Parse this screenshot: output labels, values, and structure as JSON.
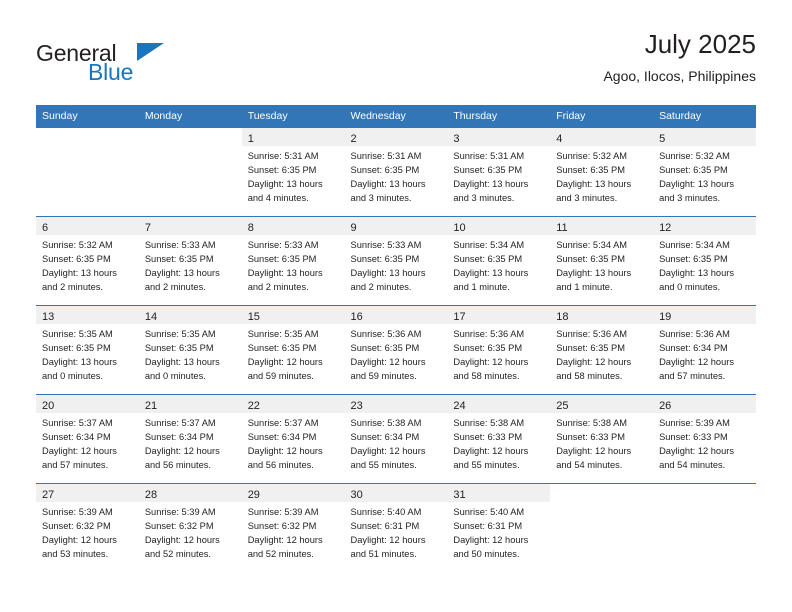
{
  "brand": {
    "name_top": "General",
    "name_bottom": "Blue",
    "triangle_icon": "triangle-logo-icon",
    "accent_color": "#1b75bc"
  },
  "header": {
    "title": "July 2025",
    "subtitle": "Agoo, Ilocos, Philippines"
  },
  "calendar": {
    "header_color": "#3276b8",
    "weekday_headers": [
      "Sunday",
      "Monday",
      "Tuesday",
      "Wednesday",
      "Thursday",
      "Friday",
      "Saturday"
    ],
    "weeks": [
      [
        {
          "day": "",
          "lines": []
        },
        {
          "day": "",
          "lines": []
        },
        {
          "day": "1",
          "lines": [
            "Sunrise: 5:31 AM",
            "Sunset: 6:35 PM",
            "Daylight: 13 hours",
            "and 4 minutes."
          ]
        },
        {
          "day": "2",
          "lines": [
            "Sunrise: 5:31 AM",
            "Sunset: 6:35 PM",
            "Daylight: 13 hours",
            "and 3 minutes."
          ]
        },
        {
          "day": "3",
          "lines": [
            "Sunrise: 5:31 AM",
            "Sunset: 6:35 PM",
            "Daylight: 13 hours",
            "and 3 minutes."
          ]
        },
        {
          "day": "4",
          "lines": [
            "Sunrise: 5:32 AM",
            "Sunset: 6:35 PM",
            "Daylight: 13 hours",
            "and 3 minutes."
          ]
        },
        {
          "day": "5",
          "lines": [
            "Sunrise: 5:32 AM",
            "Sunset: 6:35 PM",
            "Daylight: 13 hours",
            "and 3 minutes."
          ]
        }
      ],
      [
        {
          "day": "6",
          "lines": [
            "Sunrise: 5:32 AM",
            "Sunset: 6:35 PM",
            "Daylight: 13 hours",
            "and 2 minutes."
          ]
        },
        {
          "day": "7",
          "lines": [
            "Sunrise: 5:33 AM",
            "Sunset: 6:35 PM",
            "Daylight: 13 hours",
            "and 2 minutes."
          ]
        },
        {
          "day": "8",
          "lines": [
            "Sunrise: 5:33 AM",
            "Sunset: 6:35 PM",
            "Daylight: 13 hours",
            "and 2 minutes."
          ]
        },
        {
          "day": "9",
          "lines": [
            "Sunrise: 5:33 AM",
            "Sunset: 6:35 PM",
            "Daylight: 13 hours",
            "and 2 minutes."
          ]
        },
        {
          "day": "10",
          "lines": [
            "Sunrise: 5:34 AM",
            "Sunset: 6:35 PM",
            "Daylight: 13 hours",
            "and 1 minute."
          ]
        },
        {
          "day": "11",
          "lines": [
            "Sunrise: 5:34 AM",
            "Sunset: 6:35 PM",
            "Daylight: 13 hours",
            "and 1 minute."
          ]
        },
        {
          "day": "12",
          "lines": [
            "Sunrise: 5:34 AM",
            "Sunset: 6:35 PM",
            "Daylight: 13 hours",
            "and 0 minutes."
          ]
        }
      ],
      [
        {
          "day": "13",
          "lines": [
            "Sunrise: 5:35 AM",
            "Sunset: 6:35 PM",
            "Daylight: 13 hours",
            "and 0 minutes."
          ]
        },
        {
          "day": "14",
          "lines": [
            "Sunrise: 5:35 AM",
            "Sunset: 6:35 PM",
            "Daylight: 13 hours",
            "and 0 minutes."
          ]
        },
        {
          "day": "15",
          "lines": [
            "Sunrise: 5:35 AM",
            "Sunset: 6:35 PM",
            "Daylight: 12 hours",
            "and 59 minutes."
          ]
        },
        {
          "day": "16",
          "lines": [
            "Sunrise: 5:36 AM",
            "Sunset: 6:35 PM",
            "Daylight: 12 hours",
            "and 59 minutes."
          ]
        },
        {
          "day": "17",
          "lines": [
            "Sunrise: 5:36 AM",
            "Sunset: 6:35 PM",
            "Daylight: 12 hours",
            "and 58 minutes."
          ]
        },
        {
          "day": "18",
          "lines": [
            "Sunrise: 5:36 AM",
            "Sunset: 6:35 PM",
            "Daylight: 12 hours",
            "and 58 minutes."
          ]
        },
        {
          "day": "19",
          "lines": [
            "Sunrise: 5:36 AM",
            "Sunset: 6:34 PM",
            "Daylight: 12 hours",
            "and 57 minutes."
          ]
        }
      ],
      [
        {
          "day": "20",
          "lines": [
            "Sunrise: 5:37 AM",
            "Sunset: 6:34 PM",
            "Daylight: 12 hours",
            "and 57 minutes."
          ]
        },
        {
          "day": "21",
          "lines": [
            "Sunrise: 5:37 AM",
            "Sunset: 6:34 PM",
            "Daylight: 12 hours",
            "and 56 minutes."
          ]
        },
        {
          "day": "22",
          "lines": [
            "Sunrise: 5:37 AM",
            "Sunset: 6:34 PM",
            "Daylight: 12 hours",
            "and 56 minutes."
          ]
        },
        {
          "day": "23",
          "lines": [
            "Sunrise: 5:38 AM",
            "Sunset: 6:34 PM",
            "Daylight: 12 hours",
            "and 55 minutes."
          ]
        },
        {
          "day": "24",
          "lines": [
            "Sunrise: 5:38 AM",
            "Sunset: 6:33 PM",
            "Daylight: 12 hours",
            "and 55 minutes."
          ]
        },
        {
          "day": "25",
          "lines": [
            "Sunrise: 5:38 AM",
            "Sunset: 6:33 PM",
            "Daylight: 12 hours",
            "and 54 minutes."
          ]
        },
        {
          "day": "26",
          "lines": [
            "Sunrise: 5:39 AM",
            "Sunset: 6:33 PM",
            "Daylight: 12 hours",
            "and 54 minutes."
          ]
        }
      ],
      [
        {
          "day": "27",
          "lines": [
            "Sunrise: 5:39 AM",
            "Sunset: 6:32 PM",
            "Daylight: 12 hours",
            "and 53 minutes."
          ]
        },
        {
          "day": "28",
          "lines": [
            "Sunrise: 5:39 AM",
            "Sunset: 6:32 PM",
            "Daylight: 12 hours",
            "and 52 minutes."
          ]
        },
        {
          "day": "29",
          "lines": [
            "Sunrise: 5:39 AM",
            "Sunset: 6:32 PM",
            "Daylight: 12 hours",
            "and 52 minutes."
          ]
        },
        {
          "day": "30",
          "lines": [
            "Sunrise: 5:40 AM",
            "Sunset: 6:31 PM",
            "Daylight: 12 hours",
            "and 51 minutes."
          ]
        },
        {
          "day": "31",
          "lines": [
            "Sunrise: 5:40 AM",
            "Sunset: 6:31 PM",
            "Daylight: 12 hours",
            "and 50 minutes."
          ]
        },
        {
          "day": "",
          "lines": []
        },
        {
          "day": "",
          "lines": []
        }
      ]
    ]
  }
}
